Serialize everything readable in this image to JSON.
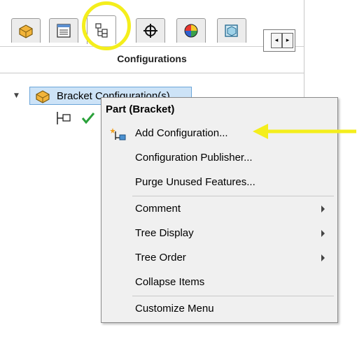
{
  "panel": {
    "title": "Configurations"
  },
  "tabs": [
    {
      "name": "featuremanager-tab",
      "icon": "part-icon"
    },
    {
      "name": "propertymanager-tab",
      "icon": "property-list-icon"
    },
    {
      "name": "configurationmanager-tab",
      "icon": "configuration-tree-icon",
      "active": true
    },
    {
      "name": "dimxpert-tab",
      "icon": "crosshair-icon"
    },
    {
      "name": "appearance-tab",
      "icon": "appearance-ball-icon"
    },
    {
      "name": "display-tab",
      "icon": "display-manager-icon"
    }
  ],
  "tree": {
    "root_label": "Bracket Configuration(s)",
    "child_icon": "configuration-icon",
    "check_icon": "green-check-icon"
  },
  "context_menu": {
    "header": "Part (Bracket)",
    "items": [
      {
        "label": "Add Configuration...",
        "icon": "add-configuration-icon",
        "submenu": false
      },
      {
        "label": "Configuration Publisher...",
        "submenu": false
      },
      {
        "label": "Purge Unused Features...",
        "submenu": false
      },
      {
        "label": "Comment",
        "submenu": true
      },
      {
        "label": "Tree Display",
        "submenu": true
      },
      {
        "label": "Tree Order",
        "submenu": true
      },
      {
        "label": "Collapse Items",
        "submenu": false
      },
      {
        "label": "Customize Menu",
        "submenu": false
      }
    ]
  },
  "colors": {
    "highlight": "#f4ee1c",
    "selection": "#cde3f7",
    "check": "#2aa13a"
  }
}
